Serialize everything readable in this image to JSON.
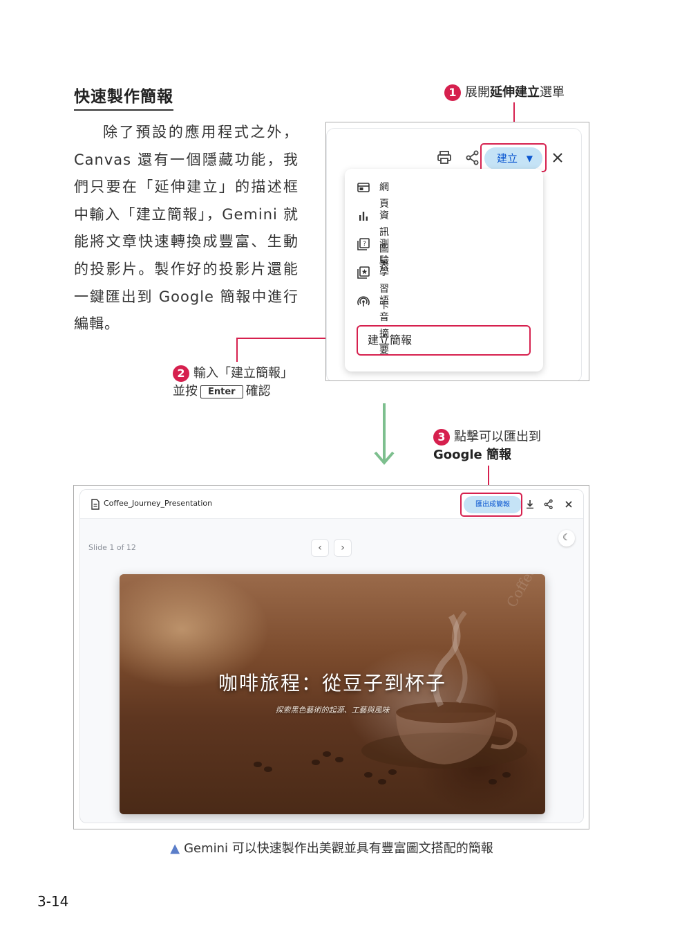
{
  "section": {
    "title": "快速製作簡報",
    "body": "除了預設的應用程式之外，Canvas 還有一個隱藏功能，我們只要在「延伸建立」的描述框中輸入「建立簡報」，Gemini 就能將文章快速轉換成豐富、生動的投影片。製作好的投影片還能一鍵匯出到 Google 簡報中進行編輯。"
  },
  "callouts": {
    "c1": {
      "num": "1",
      "pre": "展開",
      "bold": "延伸建立",
      "post": "選單"
    },
    "c2": {
      "num": "2",
      "line1": "輸入「建立簡報」",
      "pre2": "並按",
      "key": "Enter",
      "post2": "確認"
    },
    "c3": {
      "num": "3",
      "line1": "點擊可以匯出到",
      "line2": "Google 簡報"
    }
  },
  "screenshot1": {
    "create_label": "建立",
    "menu_items": [
      "網頁",
      "資訊圖表",
      "測驗",
      "學習卡",
      "語音摘要"
    ],
    "input_value": "建立簡報",
    "icons": [
      "print-icon",
      "share-icon",
      "close-icon",
      "web-icon",
      "bar-chart-icon",
      "quiz-icon",
      "flashcard-icon",
      "audio-icon"
    ]
  },
  "screenshot2": {
    "filename": "Coffee_Journey_Presentation",
    "export_label": "匯出成簡報",
    "slide_counter": "Slide 1 of 12",
    "slide_title": "咖啡旅程：從豆子到杯子",
    "slide_subtitle": "探索黑色藝術的起源、工藝與風味",
    "watermark": "Coffee"
  },
  "caption": "Gemini 可以快速製作出美觀並具有豐富圖文搭配的簡報",
  "page_number": "3-14",
  "colors": {
    "accent_red": "#d6204e",
    "button_blue": "#c5e3f6",
    "arrow_green": "#7dbf8e",
    "caption_triangle": "#5b7ec9"
  }
}
